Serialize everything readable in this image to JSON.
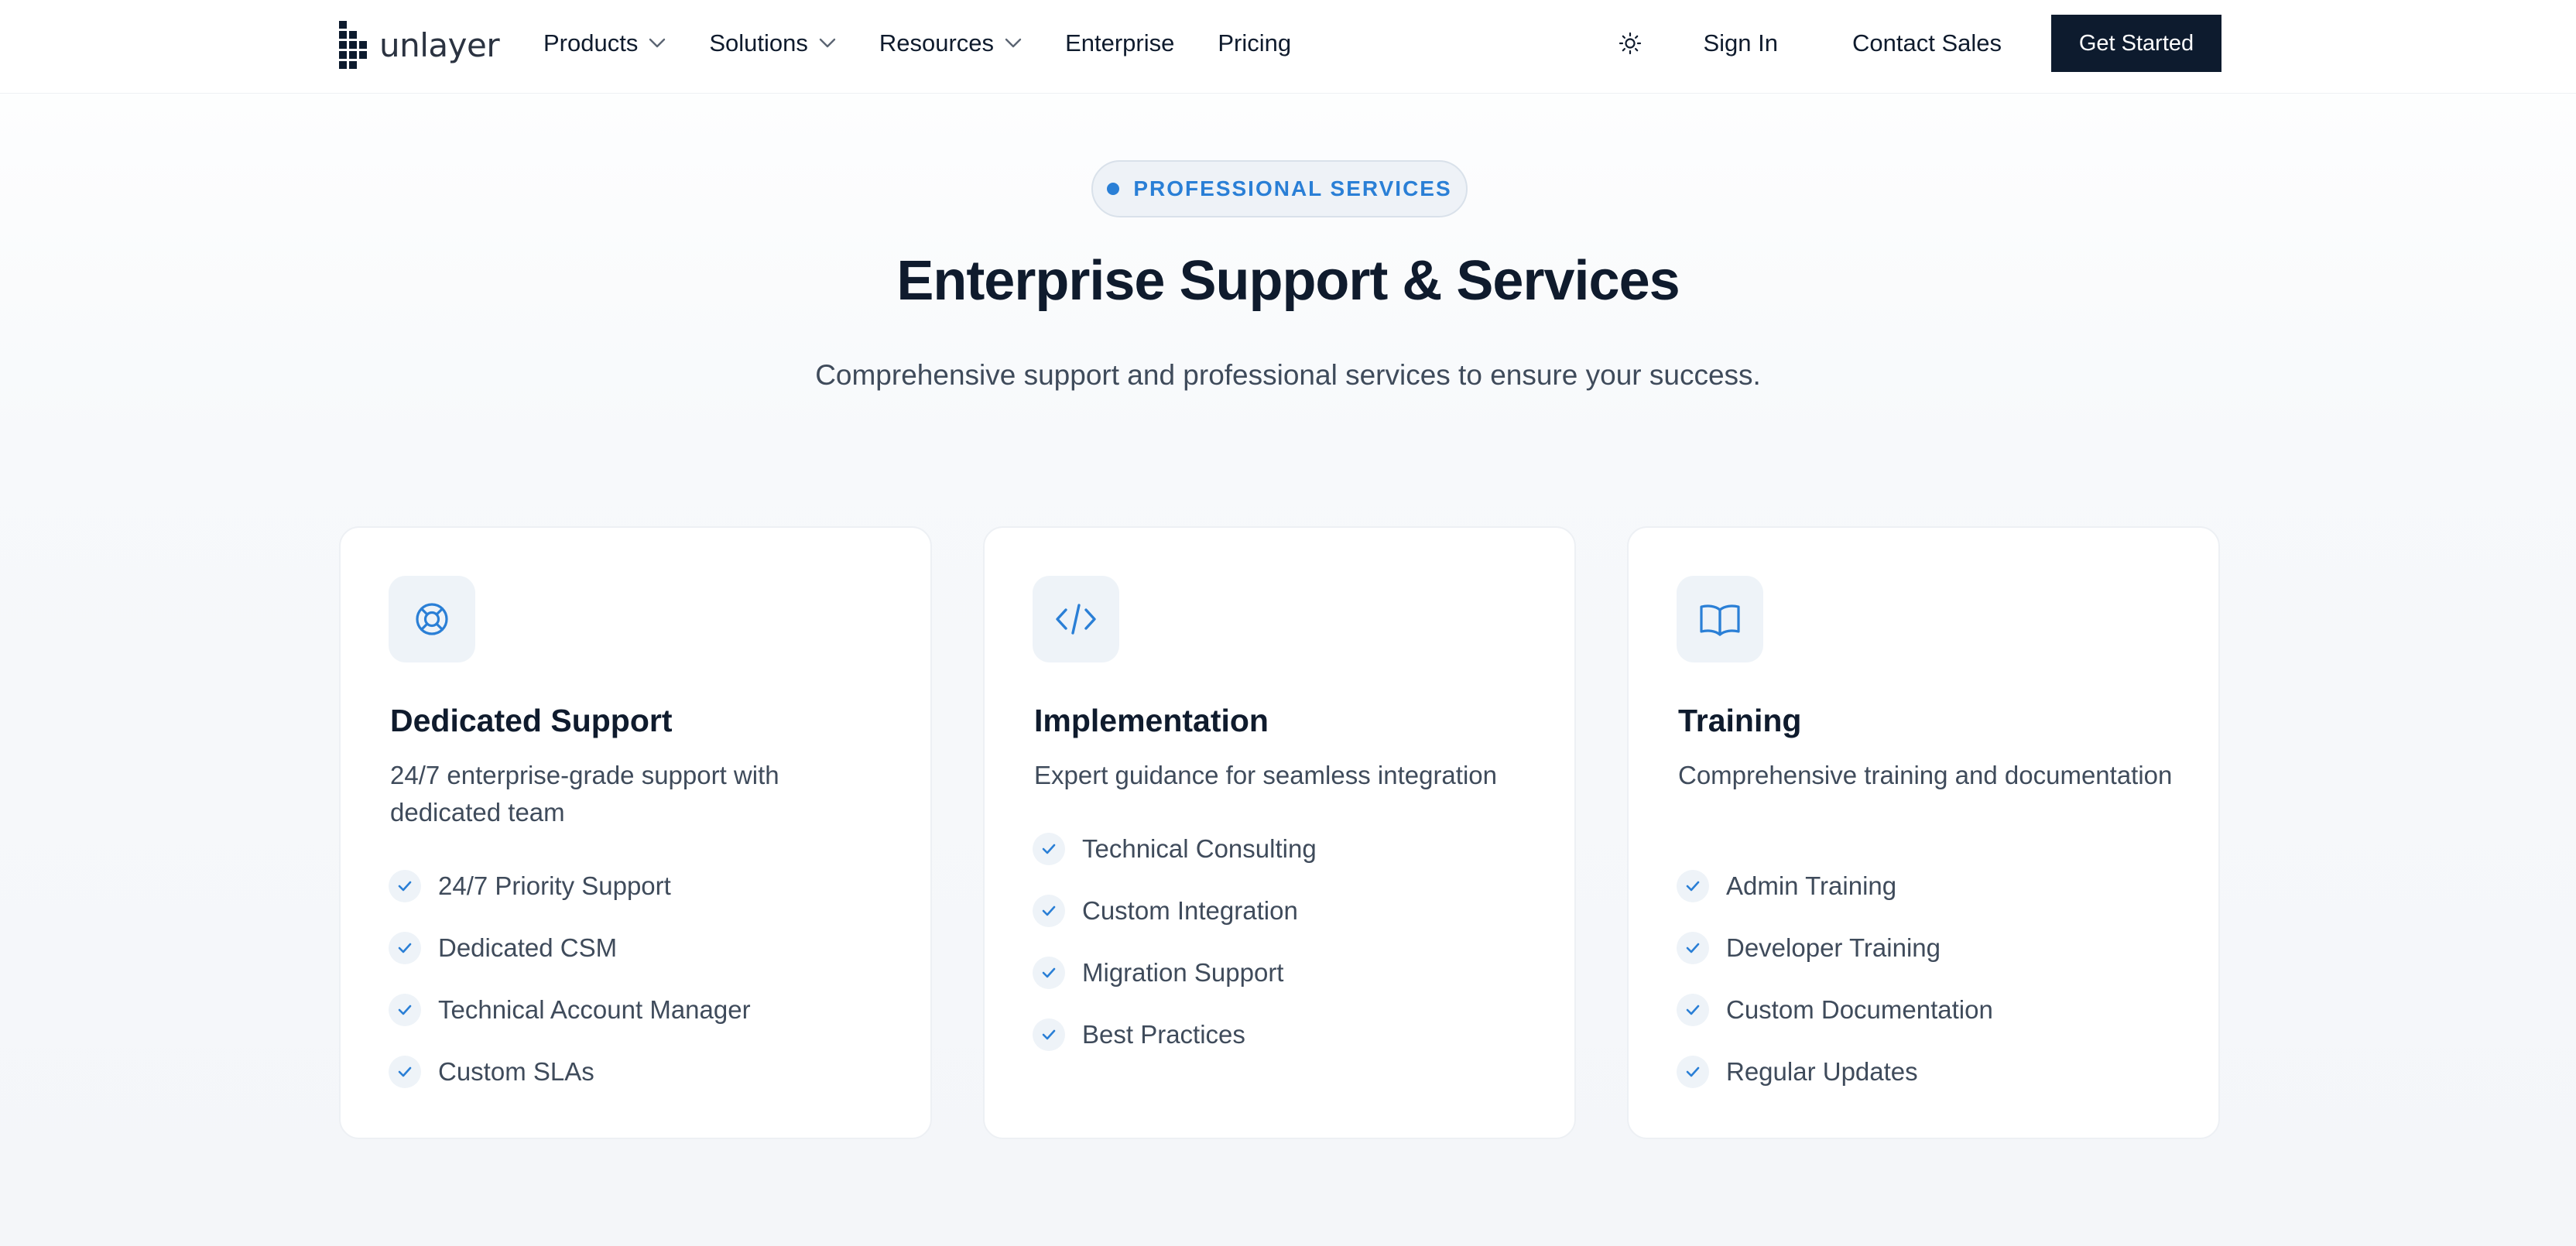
{
  "brand": {
    "name": "unlayer",
    "accent_color": "#2a7fd6",
    "dark_color": "#0d1b2e"
  },
  "nav": {
    "items": [
      {
        "label": "Products",
        "has_dropdown": true
      },
      {
        "label": "Solutions",
        "has_dropdown": true
      },
      {
        "label": "Resources",
        "has_dropdown": true
      },
      {
        "label": "Enterprise",
        "has_dropdown": false
      },
      {
        "label": "Pricing",
        "has_dropdown": false
      }
    ],
    "theme_icon": "sun-icon",
    "sign_in": "Sign In",
    "contact_sales": "Contact Sales",
    "get_started": "Get Started"
  },
  "hero": {
    "badge": "PROFESSIONAL SERVICES",
    "title": "Enterprise Support & Services",
    "subtitle": "Comprehensive support and professional services to ensure your success."
  },
  "cards": [
    {
      "icon": "life-buoy-icon",
      "title": "Dedicated Support",
      "description": "24/7 enterprise-grade support with dedicated team",
      "features": [
        "24/7 Priority Support",
        "Dedicated CSM",
        "Technical Account Manager",
        "Custom SLAs"
      ]
    },
    {
      "icon": "code-icon",
      "title": "Implementation",
      "description": "Expert guidance for seamless integration",
      "features": [
        "Technical Consulting",
        "Custom Integration",
        "Migration Support",
        "Best Practices"
      ]
    },
    {
      "icon": "book-open-icon",
      "title": "Training",
      "description": "Comprehensive training and documentation",
      "features": [
        "Admin Training",
        "Developer Training",
        "Custom Documentation",
        "Regular Updates"
      ]
    }
  ]
}
